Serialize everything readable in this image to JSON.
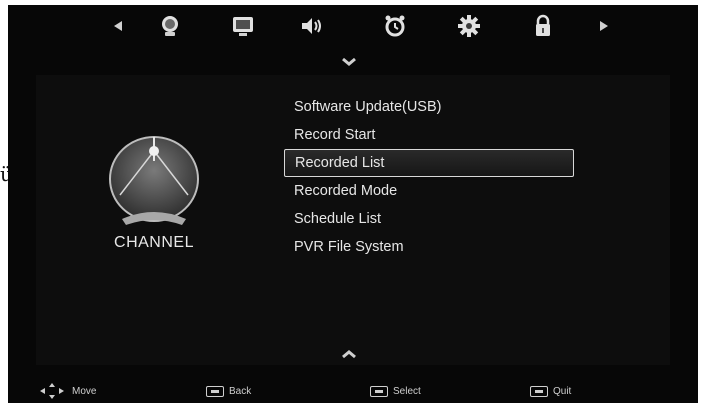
{
  "stray_glyph": "ü",
  "top_icons": [
    "arrow-left-icon",
    "picture-icon",
    "screen-icon",
    "sound-icon",
    "time-icon",
    "settings-icon",
    "lock-icon",
    "arrow-right-icon"
  ],
  "category": {
    "label": "CHANNEL",
    "icon": "satellite-dish-icon"
  },
  "menu": {
    "items": [
      {
        "label": "Software Update(USB)"
      },
      {
        "label": "Record Start"
      },
      {
        "label": "Recorded List"
      },
      {
        "label": "Recorded Mode"
      },
      {
        "label": "Schedule List"
      },
      {
        "label": "PVR File System"
      }
    ],
    "selected_label": "Recorded List"
  },
  "footer": {
    "move": "Move",
    "back": "Back",
    "select": "Select",
    "quit": "Quit"
  },
  "colors": {
    "background": "#070707",
    "text": "#e6e6e6",
    "icon": "#d9d9d9"
  }
}
